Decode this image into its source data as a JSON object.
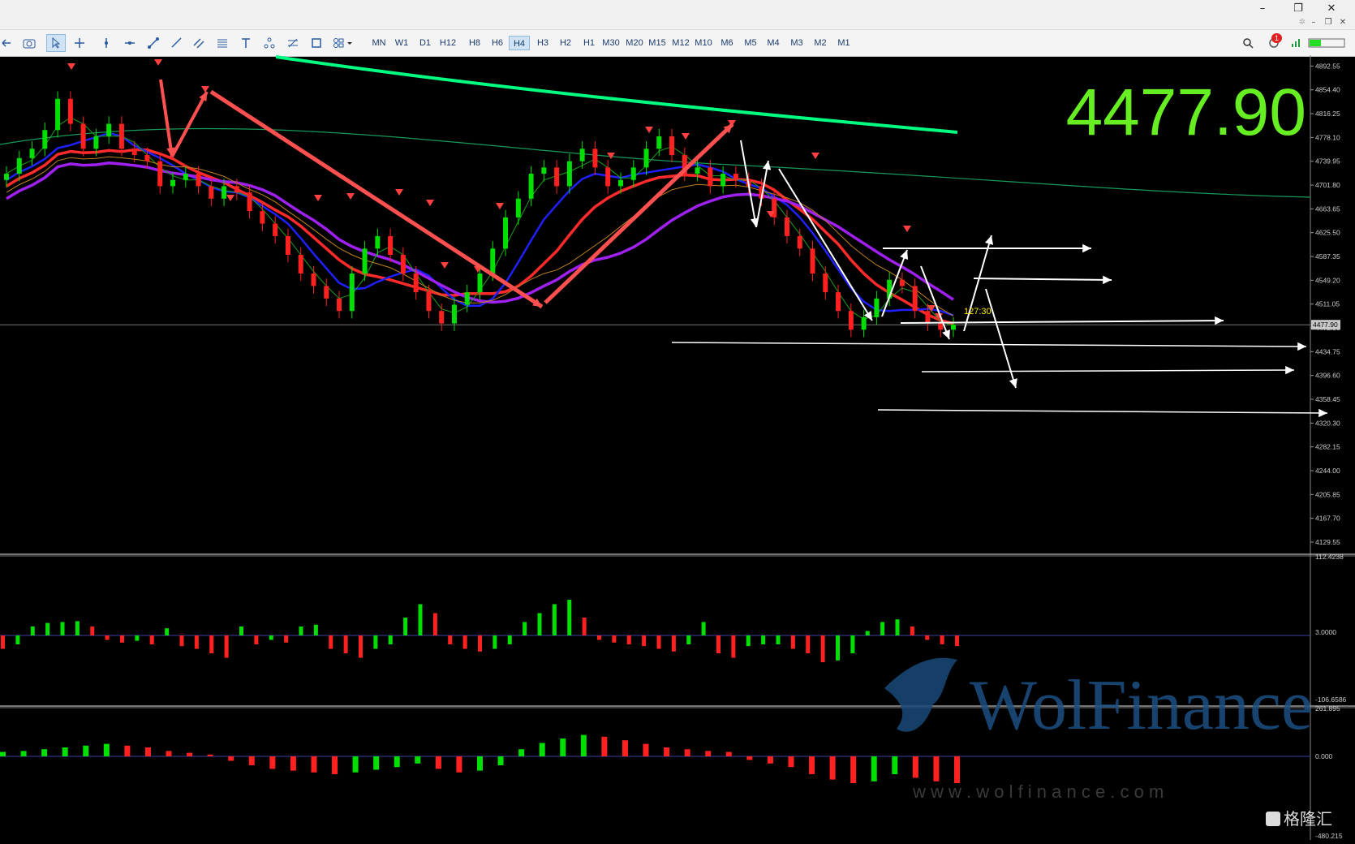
{
  "window": {
    "minimize": "–",
    "restore": "❐",
    "close": "✕"
  },
  "timeframes": [
    "MN",
    "W1",
    "D1",
    "H12",
    "H8",
    "H6",
    "H4",
    "H3",
    "H2",
    "H1",
    "M30",
    "M20",
    "M15",
    "M12",
    "M10",
    "M6",
    "M5",
    "M4",
    "M3",
    "M2",
    "M1"
  ],
  "active_timeframe": "H4",
  "notification_count": "1",
  "price_scale": [
    "4892.55",
    "4854.40",
    "4816.25",
    "4778.10",
    "4739.95",
    "4701.80",
    "4663.65",
    "4625.50",
    "4587.35",
    "4549.20",
    "4511.05",
    "4472.90",
    "4434.75",
    "4396.60",
    "4358.45",
    "4320.30",
    "4282.15",
    "4244.00",
    "4205.85",
    "4167.70",
    "4129.55"
  ],
  "current_price_label": "4477.90",
  "big_price": "4477.90",
  "countdown": "127:30",
  "indicator1_scale": {
    "top": "112.4238",
    "zero": "3.0000",
    "bottom": "-106.6586"
  },
  "indicator2_scale": {
    "top": "261.895",
    "zero": "0.000",
    "bottom": "-480.215"
  },
  "watermark": {
    "brand": "WolFinance",
    "url": "w w w . w o l f i n a n c e . c o m"
  },
  "corner_logo": "格隆汇",
  "chart_data": {
    "type": "line",
    "title": "",
    "ylim": [
      4110,
      4910
    ],
    "colors": {
      "bull": "#00e000",
      "bear": "#ff2020",
      "ma_green": "#00ff80",
      "ma_red": "#ff2a2a",
      "ma_blue": "#2020ff",
      "ma_purple": "#a020f0",
      "arrow": "#ffffff",
      "red_arrow": "#ff4040"
    },
    "candles_approx_close": [
      4720,
      4745,
      4760,
      4790,
      4840,
      4800,
      4760,
      4780,
      4800,
      4760,
      4750,
      4740,
      4700,
      4710,
      4720,
      4700,
      4680,
      4700,
      4690,
      4660,
      4640,
      4620,
      4590,
      4560,
      4540,
      4520,
      4500,
      4560,
      4600,
      4620,
      4590,
      4560,
      4530,
      4500,
      4480,
      4510,
      4530,
      4560,
      4600,
      4650,
      4680,
      4720,
      4730,
      4700,
      4740,
      4760,
      4730,
      4700,
      4710,
      4730,
      4760,
      4780,
      4750,
      4720,
      4730,
      4700,
      4720,
      4710,
      4700,
      4680,
      4650,
      4620,
      4600,
      4560,
      4530,
      4500,
      4470,
      4490,
      4520,
      4550,
      4540,
      4500,
      4480,
      4470,
      4478
    ],
    "macd_histogram_approx": [
      -15,
      -10,
      10,
      14,
      15,
      16,
      10,
      -5,
      -8,
      -6,
      -10,
      8,
      -12,
      -15,
      -20,
      -25,
      10,
      -10,
      -5,
      -8,
      10,
      12,
      -15,
      -20,
      -25,
      -15,
      -10,
      20,
      35,
      25,
      -10,
      -15,
      -18,
      -15,
      -10,
      15,
      25,
      35,
      40,
      20,
      -5,
      -8,
      -10,
      -12,
      -15,
      -18,
      -10,
      15,
      -20,
      -25,
      -12,
      -10,
      -10,
      -15,
      -20,
      -30,
      -28,
      -20,
      5,
      15,
      18,
      10,
      -5,
      -10,
      -12
    ],
    "osc_histogram_approx": [
      5,
      6,
      8,
      10,
      12,
      14,
      12,
      10,
      6,
      4,
      2,
      -5,
      -10,
      -14,
      -16,
      -18,
      -20,
      -18,
      -15,
      -12,
      -8,
      -14,
      -18,
      -16,
      -10,
      8,
      15,
      20,
      24,
      22,
      18,
      14,
      10,
      8,
      6,
      5,
      -4,
      -8,
      -12,
      -20,
      -26,
      -30,
      -28,
      -20,
      -24,
      -28,
      -30
    ]
  }
}
